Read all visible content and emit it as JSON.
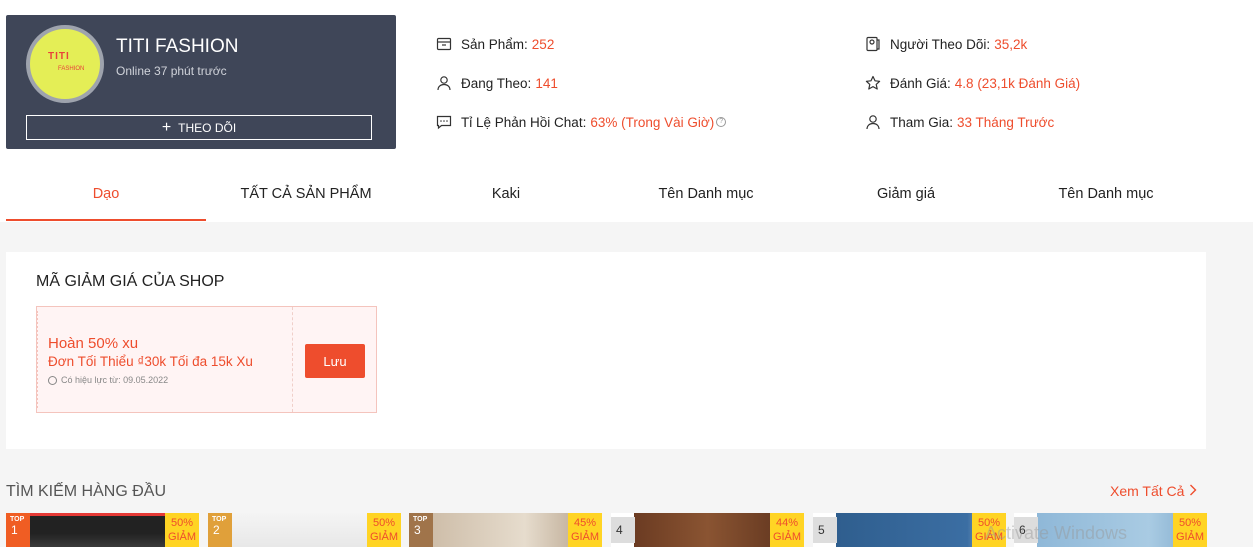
{
  "shop": {
    "logo_line1": "TITI",
    "logo_line2": "FASHION",
    "name": "TITI FASHION",
    "online": "Online 37 phút trước",
    "follow_label": "THEO DÕI"
  },
  "stats": {
    "products_label": "Sản Phẩm:",
    "products_value": "252",
    "following_label": "Đang Theo:",
    "following_value": "141",
    "chat_label": "Tỉ Lệ Phản Hồi Chat:",
    "chat_value": "63% (Trong Vài Giờ)",
    "followers_label": "Người Theo Dõi:",
    "followers_value": "35,2k",
    "rating_label": "Đánh Giá:",
    "rating_value": "4.8 (23,1k Đánh Giá)",
    "joined_label": "Tham Gia:",
    "joined_value": "33 Tháng Trước"
  },
  "tabs": [
    "Dạo",
    "TẤT CẢ SẢN PHẨM",
    "Kaki",
    "Tên Danh mục",
    "Giảm giá",
    "Tên Danh mục"
  ],
  "voucher_section": {
    "title": "MÃ GIẢM GIÁ CỦA SHOP",
    "voucher": {
      "main": "Hoàn 50% xu",
      "sub": "Đơn Tối Thiểu ₫30k Tối đa 15k Xu",
      "date": "Có hiệu lực từ: 09.05.2022",
      "save_label": "Lưu"
    }
  },
  "top_search": {
    "title": "TÌM KIẾM HÀNG ĐẦU",
    "see_all": "Xem Tất Cả",
    "top_label": "TOP",
    "items": [
      {
        "rank": "1",
        "discount": "50%",
        "discount_word": "GIẢM",
        "top": true
      },
      {
        "rank": "2",
        "discount": "50%",
        "discount_word": "GIẢM",
        "top": true
      },
      {
        "rank": "3",
        "discount": "45%",
        "discount_word": "GIẢM",
        "top": true
      },
      {
        "rank": "4",
        "discount": "44%",
        "discount_word": "GIẢM",
        "top": false
      },
      {
        "rank": "5",
        "discount": "50%",
        "discount_word": "GIẢM",
        "top": false
      },
      {
        "rank": "6",
        "discount": "50%",
        "discount_word": "GIẢM",
        "top": false
      }
    ]
  },
  "watermark": "Activate Windows",
  "colors": {
    "accent": "#ee4d2d",
    "shop_card_bg": "#3f4658",
    "discount_badge": "#ffd424"
  }
}
